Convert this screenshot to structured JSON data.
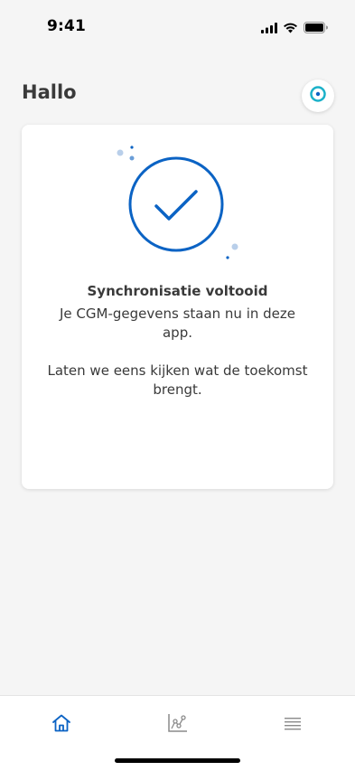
{
  "status_bar": {
    "time": "9:41",
    "icons": [
      "cellular-signal-icon",
      "wifi-icon",
      "battery-icon"
    ]
  },
  "header": {
    "title": "Hallo",
    "sensor_icon": "sensor-icon"
  },
  "card": {
    "illustration_icon": "checkmark-circle-icon",
    "title": "Synchronisatie voltooid",
    "text_1": "Je CGM-gegevens staan nu in deze app.",
    "text_2": "Laten we eens kijken wat de toekomst brengt."
  },
  "tab_bar": {
    "tabs": [
      {
        "icon": "home-icon",
        "active": true
      },
      {
        "icon": "chart-icon",
        "active": false
      },
      {
        "icon": "menu-icon",
        "active": false
      }
    ]
  },
  "colors": {
    "accent": "#0b63c4",
    "sensor_ring": "#1bb1c9",
    "background": "#f5f5f5",
    "text": "#3a3a3a",
    "inactive_icon": "#8a8a8a"
  }
}
